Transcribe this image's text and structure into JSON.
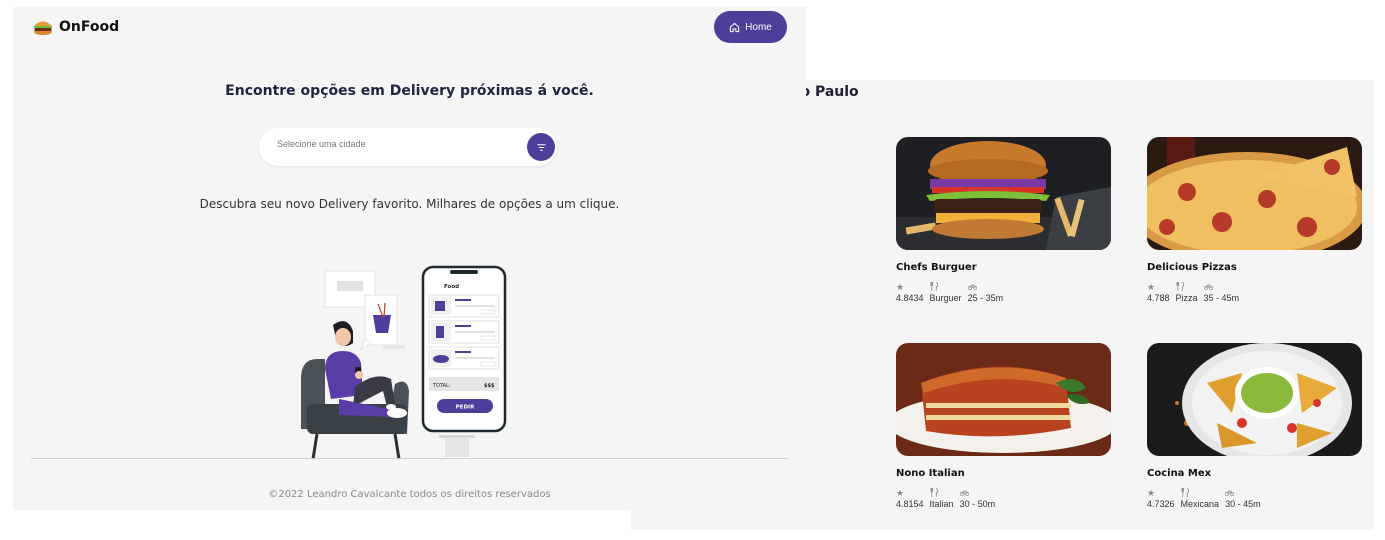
{
  "back_page": {
    "city_title": "ão Paulo",
    "restaurants": [
      {
        "name": "Chefs Burguer",
        "rating": "4.8434",
        "category": "Burguer",
        "time": "25 - 35m",
        "image": "burger-photo"
      },
      {
        "name": "Delicious Pizzas",
        "rating": "4.788",
        "category": "Pizza",
        "time": "35 - 45m",
        "image": "pizza-photo"
      },
      {
        "name": "Nono Italian",
        "rating": "4.8154",
        "category": "Italian",
        "time": "30 - 50m",
        "image": "lasagna-photo"
      },
      {
        "name": "Cocina Mex",
        "rating": "4.7326",
        "category": "Mexicana",
        "time": "30 - 45m",
        "image": "nachos-photo"
      }
    ],
    "meta_icons": [
      "star-icon",
      "cutlery-icon",
      "bike-icon"
    ]
  },
  "front_page": {
    "brand": "OnFood",
    "home_button": "Home",
    "hero_title": "Encontre opções em Delivery próximas á você.",
    "search_placeholder": "Selecione uma cidade",
    "subtitle": "Descubra seu novo Delivery favorito. Milhares de opções a um clique.",
    "phone": {
      "app_name": "Food",
      "total_label": "TOTAL:",
      "total_value": "$$$",
      "order_button": "PEDIR"
    },
    "footer": "©2022 Leandro Cavalcante todos os direitos reservados"
  },
  "colors": {
    "accent": "#4f3d9a",
    "background": "#f5f5f5"
  }
}
